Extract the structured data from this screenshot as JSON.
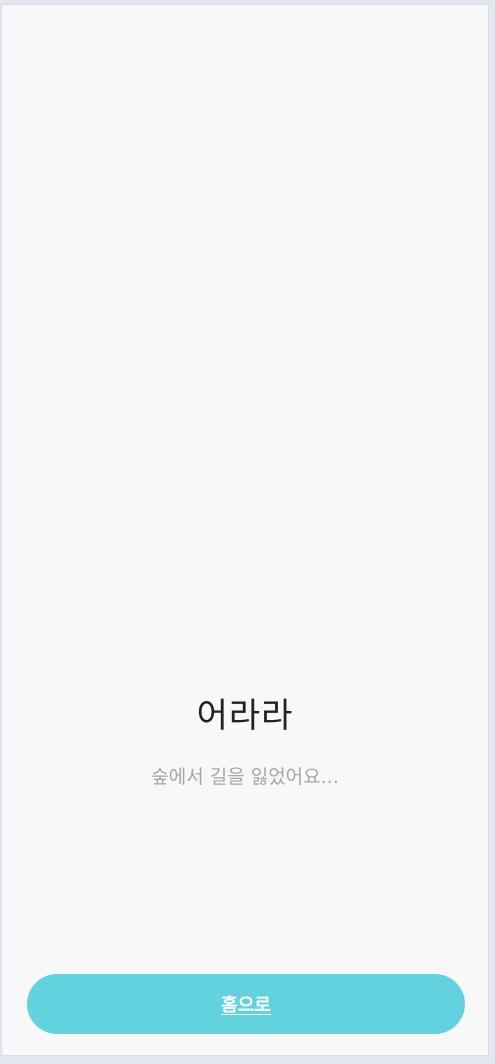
{
  "error": {
    "title": "어라라",
    "message": "숲에서 길을 잃었어요..."
  },
  "actions": {
    "home_label": "홈으로"
  },
  "colors": {
    "accent": "#62d3de",
    "background": "#f8f8f8",
    "title_text": "#222222",
    "subtitle_text": "#a6a6a6"
  }
}
